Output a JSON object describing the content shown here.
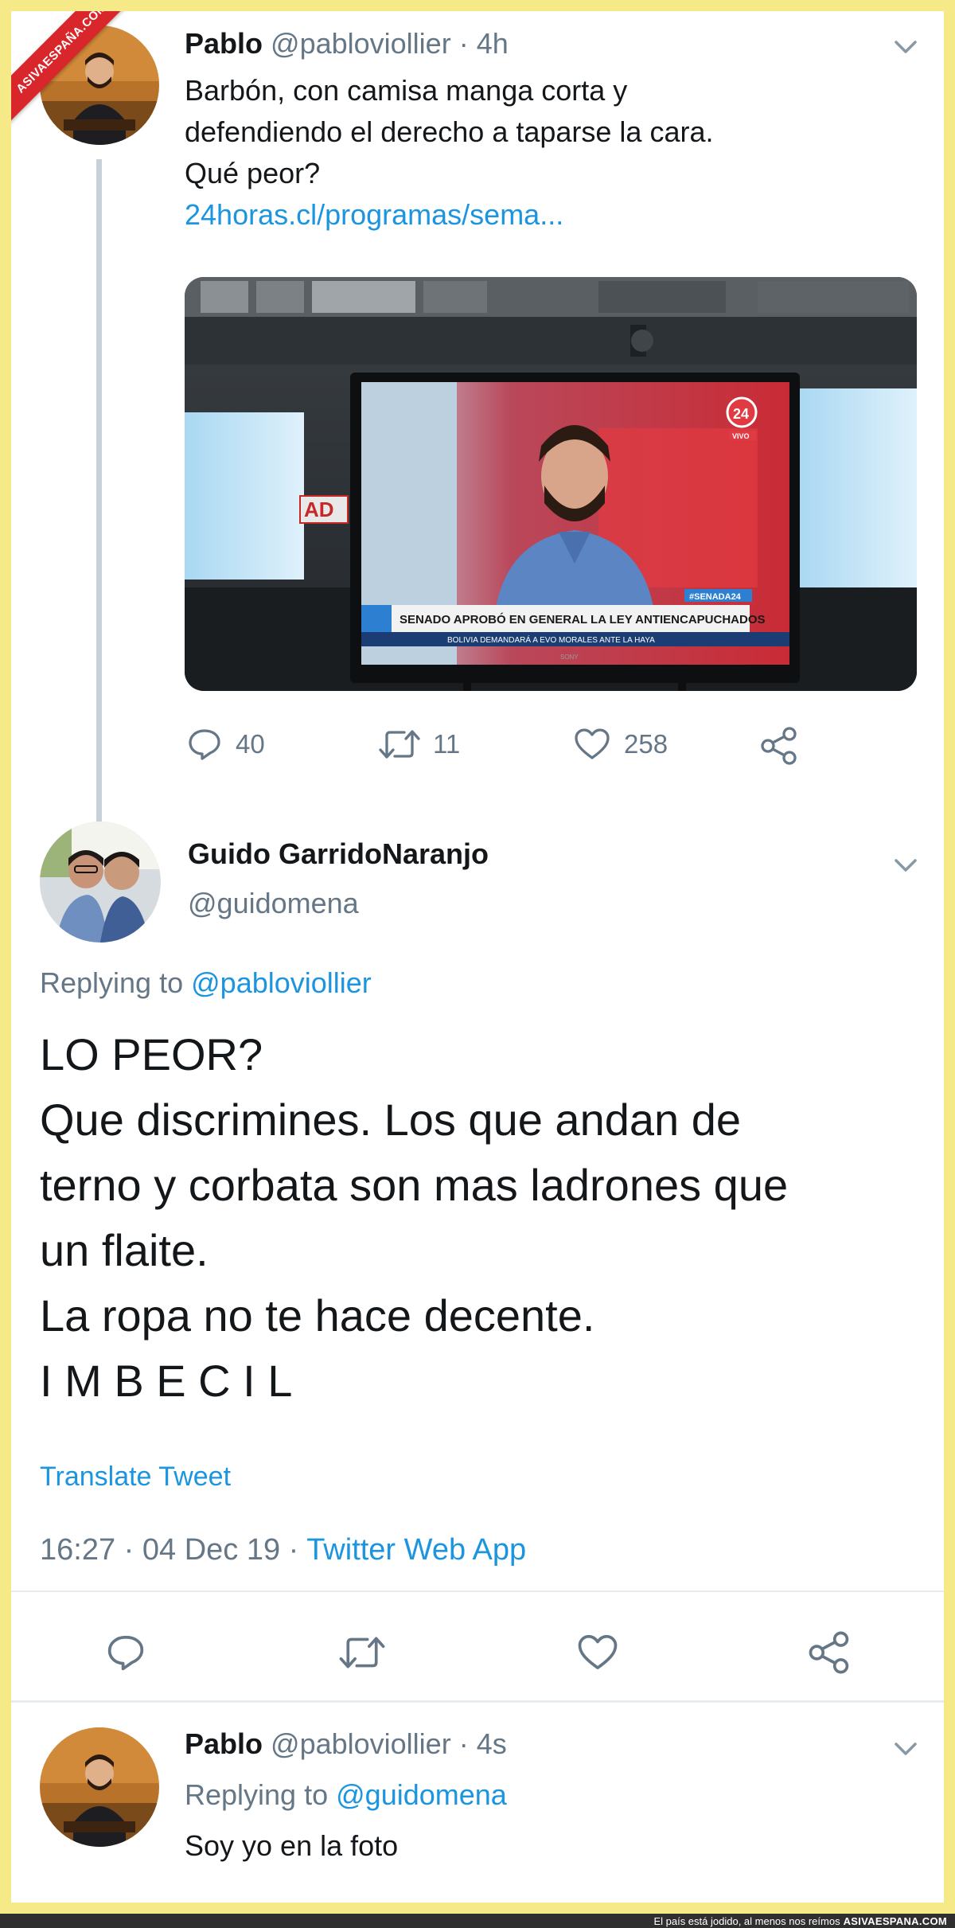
{
  "watermark": {
    "ribbon": "ASIVAESPAÑA.COM"
  },
  "tweet1": {
    "name": "Pablo",
    "handle": "@pabloviollier",
    "time": "· 4h",
    "text_lines": [
      "Barbón, con camisa manga corta y",
      "defendiendo el derecho a taparse la cara.",
      "Qué peor?"
    ],
    "link": "24horas.cl/programas/sema...",
    "image": {
      "channel_logo": "24",
      "live_badge": "VIVO",
      "hashtag": "#SENADA24",
      "lower_third": "SENADO APROBÓ EN GENERAL LA LEY ANTIENCAPUCHADOS",
      "ticker": "BOLIVIA DEMANDARÁ A EVO MORALES ANTE LA HAYA",
      "wall_logo": "AD",
      "tv_brand": "SONY"
    },
    "actions": {
      "replies": "40",
      "retweets": "11",
      "likes": "258"
    }
  },
  "tweet2": {
    "name": "Guido GarridoNaranjo",
    "handle": "@guidomena",
    "replying_prefix": "Replying to",
    "replying_to": "@pabloviollier",
    "text_lines": [
      "LO PEOR?",
      "Que discrimines. Los que andan de",
      "terno y corbata son mas ladrones que",
      "un flaite.",
      "La ropa no te hace decente.",
      "I M B E C I L"
    ],
    "translate": "Translate Tweet",
    "timestamp": "16:27 · 04 Dec 19 ·",
    "source": "Twitter Web App"
  },
  "tweet3": {
    "name": "Pablo",
    "handle": "@pabloviollier",
    "time": "· 4s",
    "replying_prefix": "Replying to",
    "replying_to": "@guidomena",
    "text": "Soy yo en la foto"
  },
  "footer": {
    "caption": "El país está jodido, al menos nos reímos",
    "brand": "ASIVAESPANA.COM"
  },
  "colors": {
    "link": "#1b95e0",
    "muted": "#657786",
    "border": "#f6ea88",
    "ribbon": "#d9262b"
  }
}
